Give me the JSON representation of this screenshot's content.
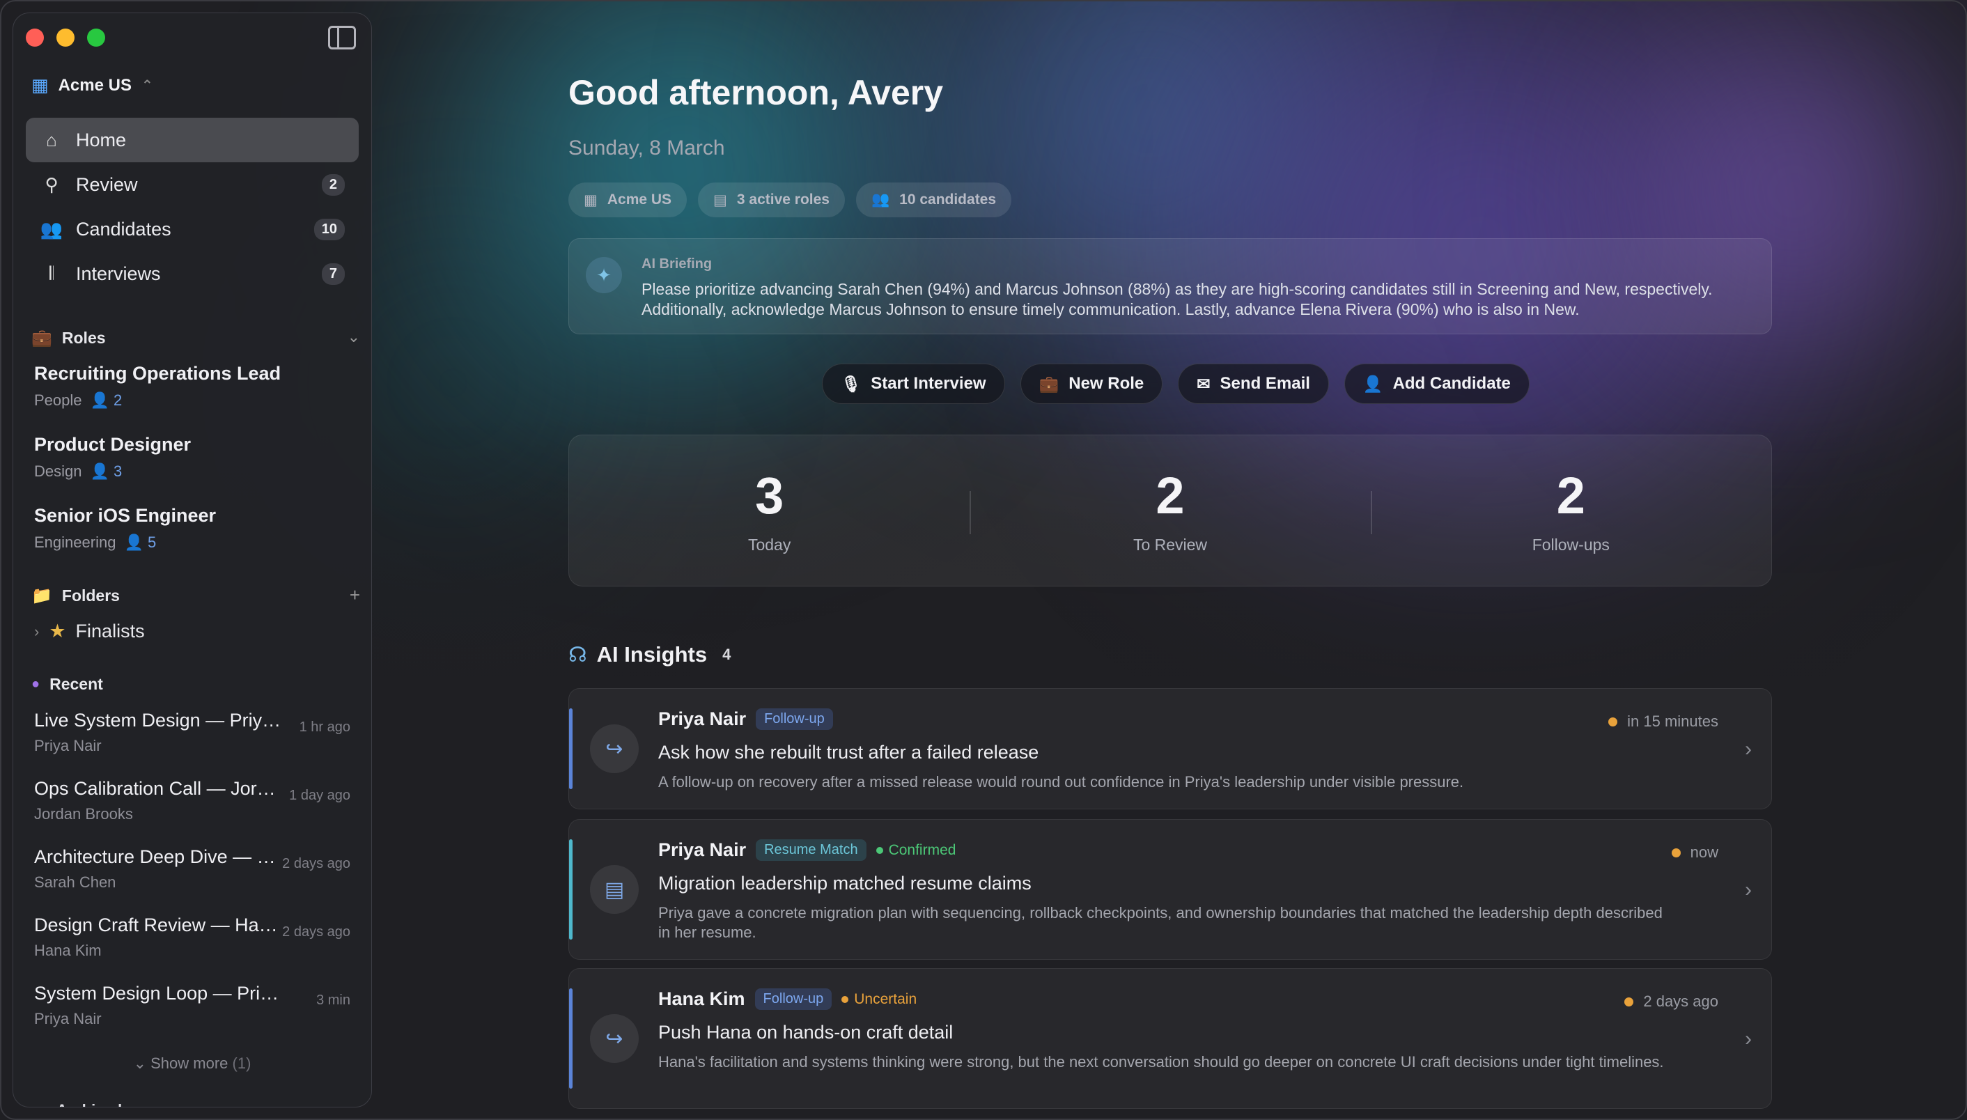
{
  "sidebar": {
    "org": "Acme US",
    "nav": [
      {
        "label": "Home",
        "badge": null
      },
      {
        "label": "Review",
        "badge": "2"
      },
      {
        "label": "Candidates",
        "badge": "10"
      },
      {
        "label": "Interviews",
        "badge": "7"
      }
    ],
    "roles_title": "Roles",
    "roles": [
      {
        "title": "Recruiting Operations Lead",
        "dept": "People",
        "count": "2"
      },
      {
        "title": "Product Designer",
        "dept": "Design",
        "count": "3"
      },
      {
        "title": "Senior iOS Engineer",
        "dept": "Engineering",
        "count": "5"
      }
    ],
    "folders_title": "Folders",
    "folders": [
      {
        "label": "Finalists"
      }
    ],
    "recent_title": "Recent",
    "recent": [
      {
        "title": "Live System Design — Priya Nair",
        "person": "Priya Nair",
        "time": "1 hr ago"
      },
      {
        "title": "Ops Calibration Call — Jordan Brooks",
        "person": "Jordan Brooks",
        "time": "1 day ago"
      },
      {
        "title": "Architecture Deep Dive — Sarah Chen",
        "person": "Sarah Chen",
        "time": "2 days ago"
      },
      {
        "title": "Design Craft Review — Hana Kim",
        "person": "Hana Kim",
        "time": "2 days ago"
      },
      {
        "title": "System Design Loop — Priya Nair",
        "person": "Priya Nair",
        "time": "3 min"
      }
    ],
    "show_more": "Show more",
    "show_more_count": "(1)",
    "archived_title": "Archived"
  },
  "main": {
    "greeting": "Good afternoon, Avery",
    "date": "Sunday, 8 March",
    "chips": [
      {
        "label": "Acme US",
        "icon": "building-icon"
      },
      {
        "label": "3 active roles",
        "icon": "briefcase-icon"
      },
      {
        "label": "10 candidates",
        "icon": "people-icon"
      }
    ],
    "briefing": {
      "label": "AI Briefing",
      "text": "Please prioritize advancing Sarah Chen (94%) and Marcus Johnson (88%) as they are high-scoring candidates still in Screening and New, respectively. Additionally, acknowledge Marcus Johnson to ensure timely communication. Lastly, advance Elena Rivera (90%) who is also in New."
    },
    "actions": [
      {
        "label": "Start Interview",
        "icon": "mic-icon"
      },
      {
        "label": "New Role",
        "icon": "briefcase-icon"
      },
      {
        "label": "Send Email",
        "icon": "mail-icon"
      },
      {
        "label": "Add Candidate",
        "icon": "add-person-icon"
      }
    ],
    "stats": [
      {
        "value": "3",
        "label": "Today"
      },
      {
        "value": "2",
        "label": "To Review"
      },
      {
        "value": "2",
        "label": "Follow-ups"
      }
    ],
    "insights_title": "AI Insights",
    "insights_count": "4",
    "insights": [
      {
        "name": "Priya Nair",
        "tag": "Follow-up",
        "status": "",
        "when": "in 15 minutes",
        "title": "Ask how she rebuilt trust after a failed release",
        "desc": "A follow-up on recovery after a missed release would round out confidence in Priya's leadership under visible pressure."
      },
      {
        "name": "Priya Nair",
        "tag": "Resume Match",
        "status": "Confirmed",
        "when": "now",
        "title": "Migration leadership matched resume claims",
        "desc": "Priya gave a concrete migration plan with sequencing, rollback checkpoints, and ownership boundaries that matched the leadership depth described in her resume."
      },
      {
        "name": "Hana Kim",
        "tag": "Follow-up",
        "status": "Uncertain",
        "when": "2 days ago",
        "title": "Push Hana on hands-on craft detail",
        "desc": "Hana's facilitation and systems thinking were strong, but the next conversation should go deeper on concrete UI craft decisions under tight timelines."
      }
    ]
  },
  "colors": {
    "accent_blue": "#5aa9ff",
    "follow_up_bar": "#5b84d8",
    "resume_bar": "#4fb8cc",
    "confirmed": "#4cc777",
    "uncertain": "#e9a23b"
  }
}
